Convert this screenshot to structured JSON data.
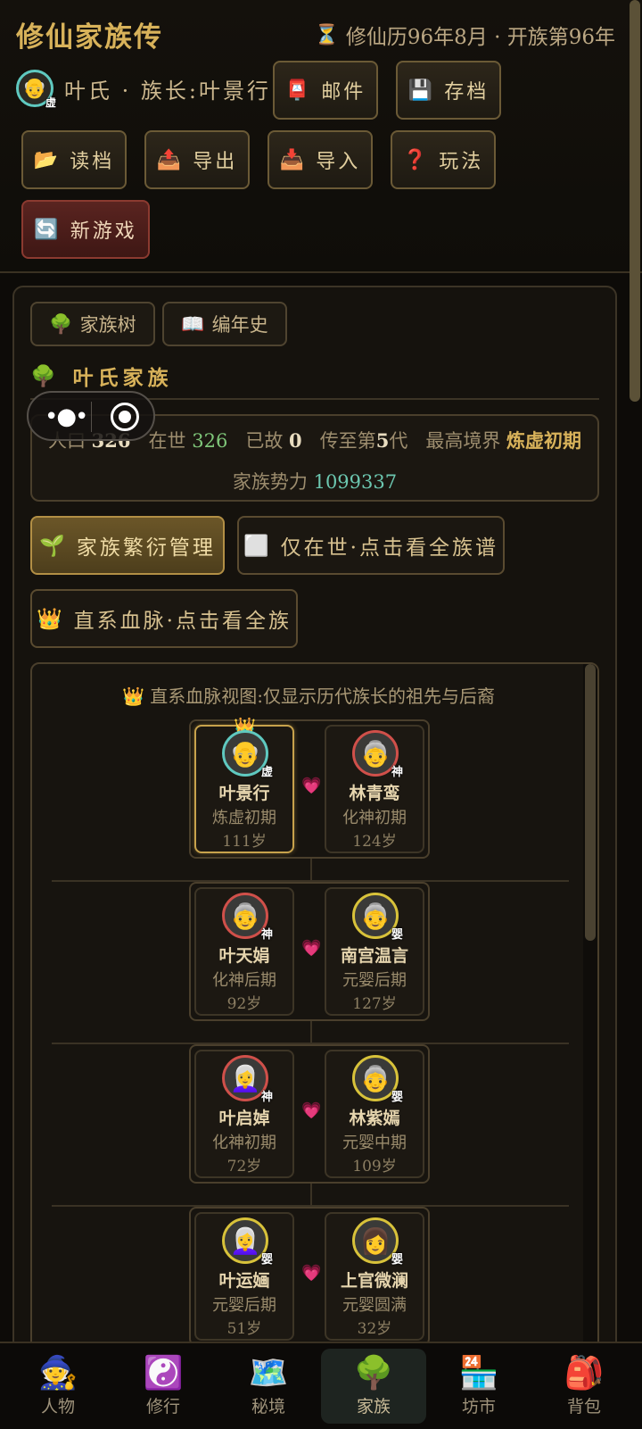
{
  "header": {
    "app_title": "修仙家族传",
    "calendar_icon": "⏳",
    "calendar_text": "修仙历96年8月 · 开族第96年",
    "patriarch_avatar": "👴",
    "patriarch_badge": "虚",
    "patriarch_label": "叶氏 · 族长:叶景行",
    "buttons": {
      "mail": {
        "icon": "📮",
        "label": "邮件"
      },
      "save": {
        "icon": "💾",
        "label": "存档"
      },
      "load": {
        "icon": "📂",
        "label": "读档"
      },
      "export": {
        "icon": "📤",
        "label": "导出"
      },
      "import": {
        "icon": "📥",
        "label": "导入"
      },
      "help": {
        "icon": "❓",
        "label": "玩法"
      },
      "new_game": {
        "icon": "🔄",
        "label": "新游戏"
      }
    }
  },
  "tabs": {
    "family_tree": {
      "icon": "🌳",
      "label": "家族树"
    },
    "chronicle": {
      "icon": "📖",
      "label": "编年史"
    }
  },
  "family": {
    "icon": "🌳",
    "name": "叶氏家族",
    "stats": {
      "population_label": "人口",
      "population": "326",
      "alive_label": "在世",
      "alive": "326",
      "dead_label": "已故",
      "dead": "0",
      "generation_prefix": "传至第",
      "generation": "5",
      "generation_suffix": "代",
      "highest_realm_label": "最高境界",
      "highest_realm": "炼虚初期",
      "power_label": "家族势力",
      "power": "1099337"
    }
  },
  "actions": {
    "breeding": {
      "icon": "🌱",
      "label": "家族繁衍管理"
    },
    "alive_only": {
      "icon": "⬜",
      "label": "仅在世·点击看全族谱"
    },
    "direct_line": {
      "icon": "👑",
      "label": "直系血脉·点击看全族"
    }
  },
  "lineage": {
    "caption_icon": "👑",
    "caption": "直系血脉视图:仅显示历代族长的祖先与后裔",
    "heart_icon": "💗",
    "crown_icon": "👑",
    "couples": [
      {
        "left": {
          "avatar": "👴",
          "badge": "虚",
          "name": "叶景行",
          "realm": "炼虚初期",
          "age": "111岁"
        },
        "right": {
          "avatar": "👵",
          "badge": "神",
          "name": "林青鸾",
          "realm": "化神初期",
          "age": "124岁"
        }
      },
      {
        "left": {
          "avatar": "👵",
          "badge": "神",
          "name": "叶天娟",
          "realm": "化神后期",
          "age": "92岁"
        },
        "right": {
          "avatar": "👵",
          "badge": "婴",
          "name": "南宫温言",
          "realm": "元婴后期",
          "age": "127岁"
        }
      },
      {
        "left": {
          "avatar": "👩‍🦳",
          "badge": "神",
          "name": "叶启婥",
          "realm": "化神初期",
          "age": "72岁"
        },
        "right": {
          "avatar": "👵",
          "badge": "婴",
          "name": "林紫嫣",
          "realm": "元婴中期",
          "age": "109岁"
        }
      },
      {
        "left": {
          "avatar": "👩‍🦳",
          "badge": "婴",
          "name": "叶运婳",
          "realm": "元婴后期",
          "age": "51岁"
        },
        "right": {
          "avatar": "👩",
          "badge": "婴",
          "name": "上官微澜",
          "realm": "元婴圆满",
          "age": "32岁"
        }
      }
    ]
  },
  "nav": [
    {
      "icon": "🧙",
      "label": "人物"
    },
    {
      "icon": "☯️",
      "label": "修行"
    },
    {
      "icon": "🗺️",
      "label": "秘境"
    },
    {
      "icon": "🌳",
      "label": "家族"
    },
    {
      "icon": "🏪",
      "label": "坊市"
    },
    {
      "icon": "🎒",
      "label": "背包"
    }
  ],
  "colors": {
    "accent_gold": "#d8b25a",
    "alive_green": "#7fc77a",
    "power_teal": "#6cc7b0",
    "new_game_red": "#5a2420"
  }
}
